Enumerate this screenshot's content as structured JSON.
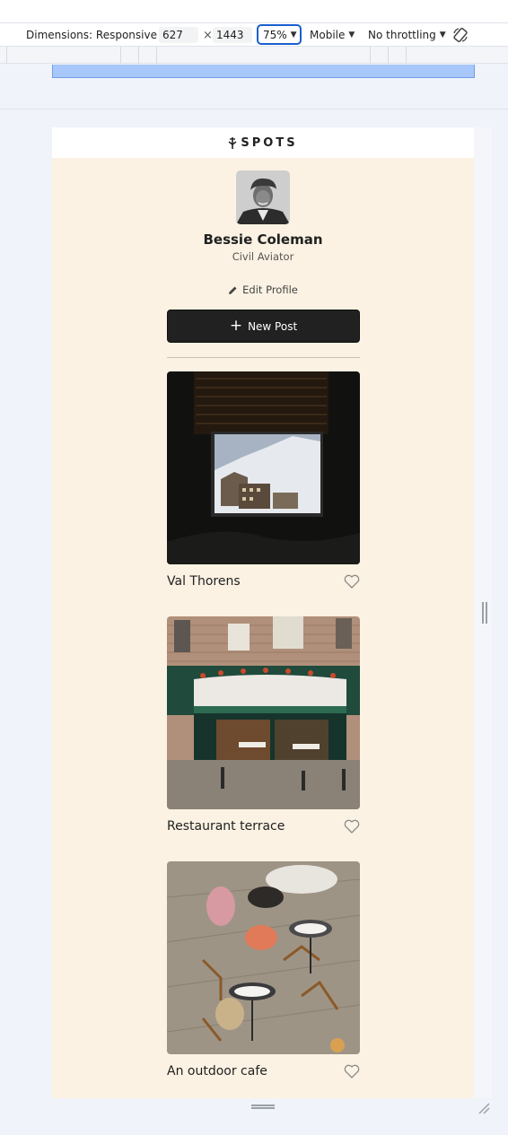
{
  "devtools": {
    "dimensions_label": "Dimensions: Responsive",
    "width_value": "627",
    "times": "×",
    "height_value": "1443",
    "zoom": "75%",
    "device_mode": "Mobile",
    "throttling": "No throttling",
    "rotate_icon": "rotate-icon"
  },
  "app": {
    "logo_text": "SPOTS",
    "logo_icon": "spots-logo-icon"
  },
  "profile": {
    "name": "Bessie Coleman",
    "description": "Civil Aviator",
    "edit_label": "Edit Profile",
    "edit_icon": "pencil-icon",
    "new_post_label": "New Post",
    "new_post_icon": "plus-icon"
  },
  "cards": [
    {
      "title": "Val Thorens",
      "like_icon": "heart-icon"
    },
    {
      "title": "Restaurant terrace",
      "like_icon": "heart-icon"
    },
    {
      "title": "An outdoor cafe",
      "like_icon": "heart-icon"
    }
  ],
  "colors": {
    "page_bg": "#fbf2e3",
    "button_bg": "#212121",
    "accent_blue": "#1a5fd0"
  }
}
